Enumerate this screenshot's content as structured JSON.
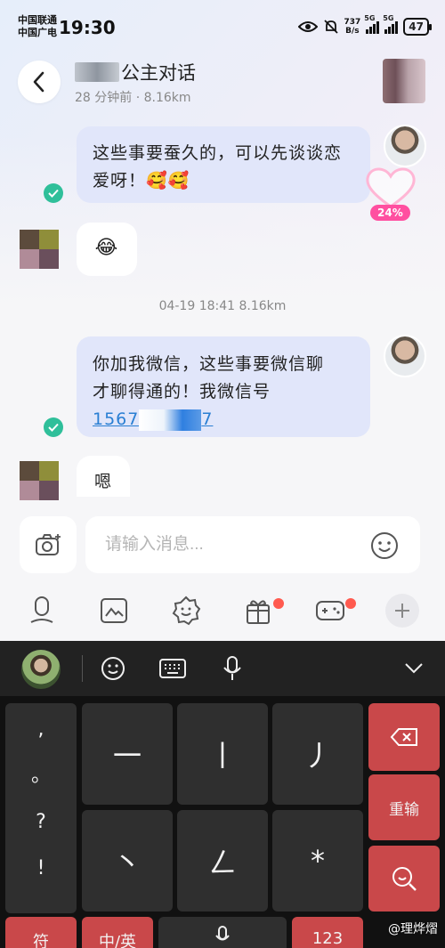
{
  "status_bar": {
    "carrier_line1": "中国联通",
    "carrier_line2": "中国广电",
    "time": "19:30",
    "net_speed_value": "737",
    "net_speed_unit": "B/s",
    "signal1_label": "5G",
    "signal2_label": "5G",
    "battery": "47"
  },
  "header": {
    "title": "公主对话",
    "subtitle": "28 分钟前 · 8.16km"
  },
  "messages": [
    {
      "from": "self",
      "text": "这些事要蚕久的，可以先谈谈恋爱呀！🥰🥰",
      "read": true
    },
    {
      "from": "peer",
      "text": "😂"
    },
    {
      "from": "self",
      "text_line1": "你加我微信，这些事要微信聊",
      "text_line2": "才聊得通的！我微信号",
      "phone_prefix": "1567",
      "phone_suffix": "7",
      "read": true
    },
    {
      "from": "peer",
      "text": "嗯"
    }
  ],
  "heart_widget": {
    "percent": "24%"
  },
  "divider": {
    "time": "04-19 18:41",
    "distance": "8.16km"
  },
  "input": {
    "placeholder": "请输入消息..."
  },
  "keyboard": {
    "punctuation": [
      ",",
      "。",
      "?",
      "!"
    ],
    "row1": [
      "一",
      "丨",
      "丿"
    ],
    "row2": [
      "丶",
      "ㄥ",
      "*"
    ],
    "reset_label": "重输",
    "bottom_left": "符",
    "bottom_zh": "中/英",
    "bottom_num": "123"
  },
  "watermark": "@理烨熠",
  "colors": {
    "self_bubble": "#e1e6fa",
    "read_check": "#2fbf9a",
    "heart_pink": "#ff4fa0",
    "key_red": "#c9484a",
    "link_blue": "#2a7fd3"
  }
}
